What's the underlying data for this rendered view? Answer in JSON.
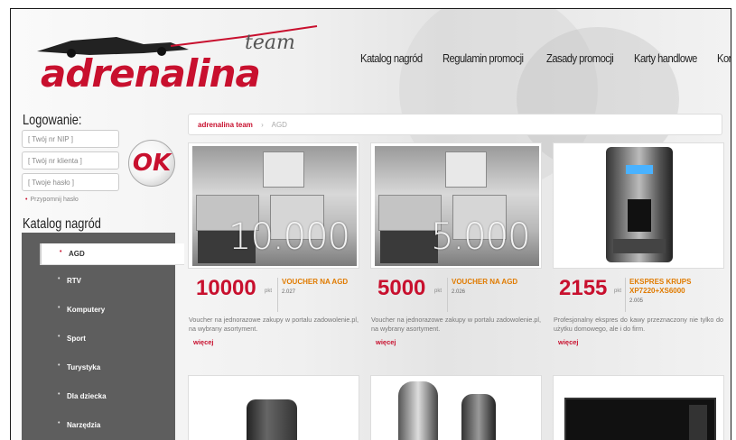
{
  "logo": {
    "brand": "adrenalina",
    "suffix": "team"
  },
  "nav": [
    "Katalog nagród",
    "Regulamin promocji",
    "Zasady promocji",
    "Karty handlowe",
    "Kontakt"
  ],
  "login": {
    "title": "Logowanie:",
    "nip_placeholder": "[ Twój nr NIP ]",
    "client_placeholder": "[ Twój nr klienta ]",
    "password_placeholder": "[ Twoje hasło ]",
    "ok_label": "OK",
    "forgot": "Przypomnij hasło"
  },
  "catalog": {
    "title": "Katalog nagród",
    "items": [
      "AGD",
      "RTV",
      "Komputery",
      "Sport",
      "Turystyka",
      "Dla dziecka",
      "Narzędzia"
    ],
    "active": "AGD"
  },
  "breadcrumb": {
    "home": "adrenalina team",
    "separator": "›",
    "current": "AGD"
  },
  "products": [
    {
      "image_text": "10.000",
      "price": "10000",
      "unit": "pkt",
      "title": "VOUCHER NA AGD",
      "code": "2.027",
      "desc": "Voucher na jednorazowe zakupy w portalu zadowolenie.pl, na wybrany asortyment.",
      "more": "więcej"
    },
    {
      "image_text": "5.000",
      "price": "5000",
      "unit": "pkt",
      "title": "VOUCHER NA AGD",
      "code": "2.026",
      "desc": "Voucher na jednorazowe zakupy w portalu zadowolenie.pl, na wybrany asortyment.",
      "more": "więcej"
    },
    {
      "image_text": "",
      "price": "2155",
      "unit": "pkt",
      "title": "EKSPRES KRUPS XP7220+XS6000",
      "code": "2.005",
      "desc": "Profesjonalny ekspres do kawy przeznaczony nie tylko do użytku domowego, ale i do firm.",
      "more": "więcej"
    }
  ],
  "colors": {
    "brand_red": "#c8102e",
    "title_orange": "#e07b00",
    "menu_gray": "#5e5e5e"
  }
}
